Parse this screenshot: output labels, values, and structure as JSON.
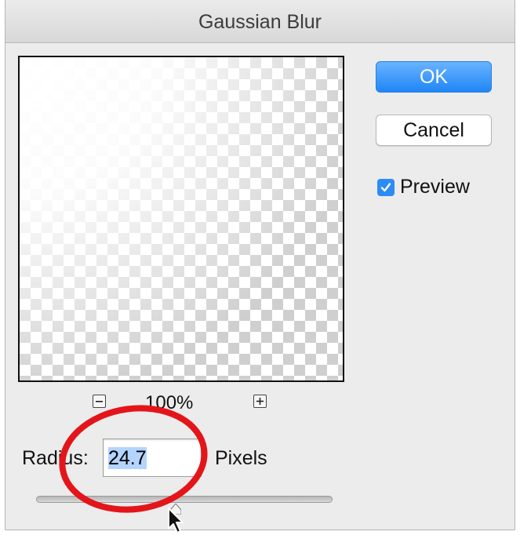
{
  "dialog": {
    "title": "Gaussian Blur"
  },
  "preview_pane": {
    "zoom_level": "100%",
    "zoom_out_icon": "minus-square-icon",
    "zoom_in_icon": "plus-square-icon"
  },
  "buttons": {
    "ok_label": "OK",
    "cancel_label": "Cancel"
  },
  "preview_toggle": {
    "label": "Preview",
    "checked": true
  },
  "radius": {
    "label": "Radius:",
    "value": "24.7",
    "units": "Pixels",
    "slider_fraction": 0.47
  },
  "annotations": {
    "highlight_color": "#e3151a",
    "cursor_icon": "arrow-cursor-icon"
  },
  "colors": {
    "accent": "#1f86f6",
    "selection": "#b3d4fc"
  }
}
